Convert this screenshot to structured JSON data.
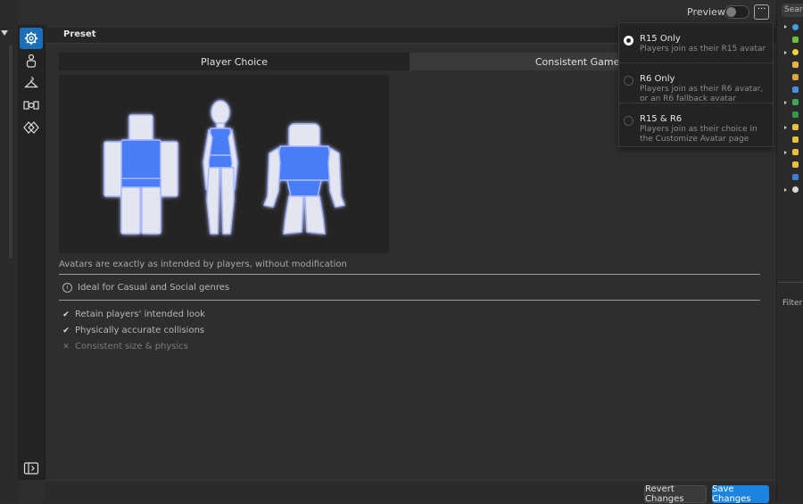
{
  "header": {
    "preview_label": "Preview",
    "preview_toggle_on": false,
    "more_label": "···",
    "section_title": "Preset"
  },
  "tabs": [
    {
      "label": "Player Choice",
      "active": true
    },
    {
      "label": "Consistent Gamepla",
      "active": false
    }
  ],
  "content": {
    "description": "Avatars are exactly as intended by players, without modification",
    "info_text": "Ideal for Casual and Social genres",
    "features": [
      {
        "label": "Retain players' intended look",
        "enabled": true
      },
      {
        "label": "Physically accurate collisions",
        "enabled": true
      },
      {
        "label": "Consistent size & physics",
        "enabled": false
      }
    ]
  },
  "popup": {
    "options": [
      {
        "title": "R15 Only",
        "subtitle": "Players join as their R15 avatar",
        "selected": true
      },
      {
        "title": "R6 Only",
        "subtitle": "Players join as their R6 avatar, or an R6 fallback avatar",
        "selected": false
      },
      {
        "title": "R15 & R6",
        "subtitle": "Players join as their choice in the Customize Avatar page",
        "selected": false
      }
    ]
  },
  "footer": {
    "revert_label": "Revert Changes",
    "save_label": "Save Changes"
  },
  "right_panel": {
    "search_placeholder": "Search",
    "filter_label": "Filter P"
  },
  "colors": {
    "accent": "#1b84e0",
    "avatar_body": "#4a7bf7",
    "avatar_limb": "#e4e6ef"
  }
}
